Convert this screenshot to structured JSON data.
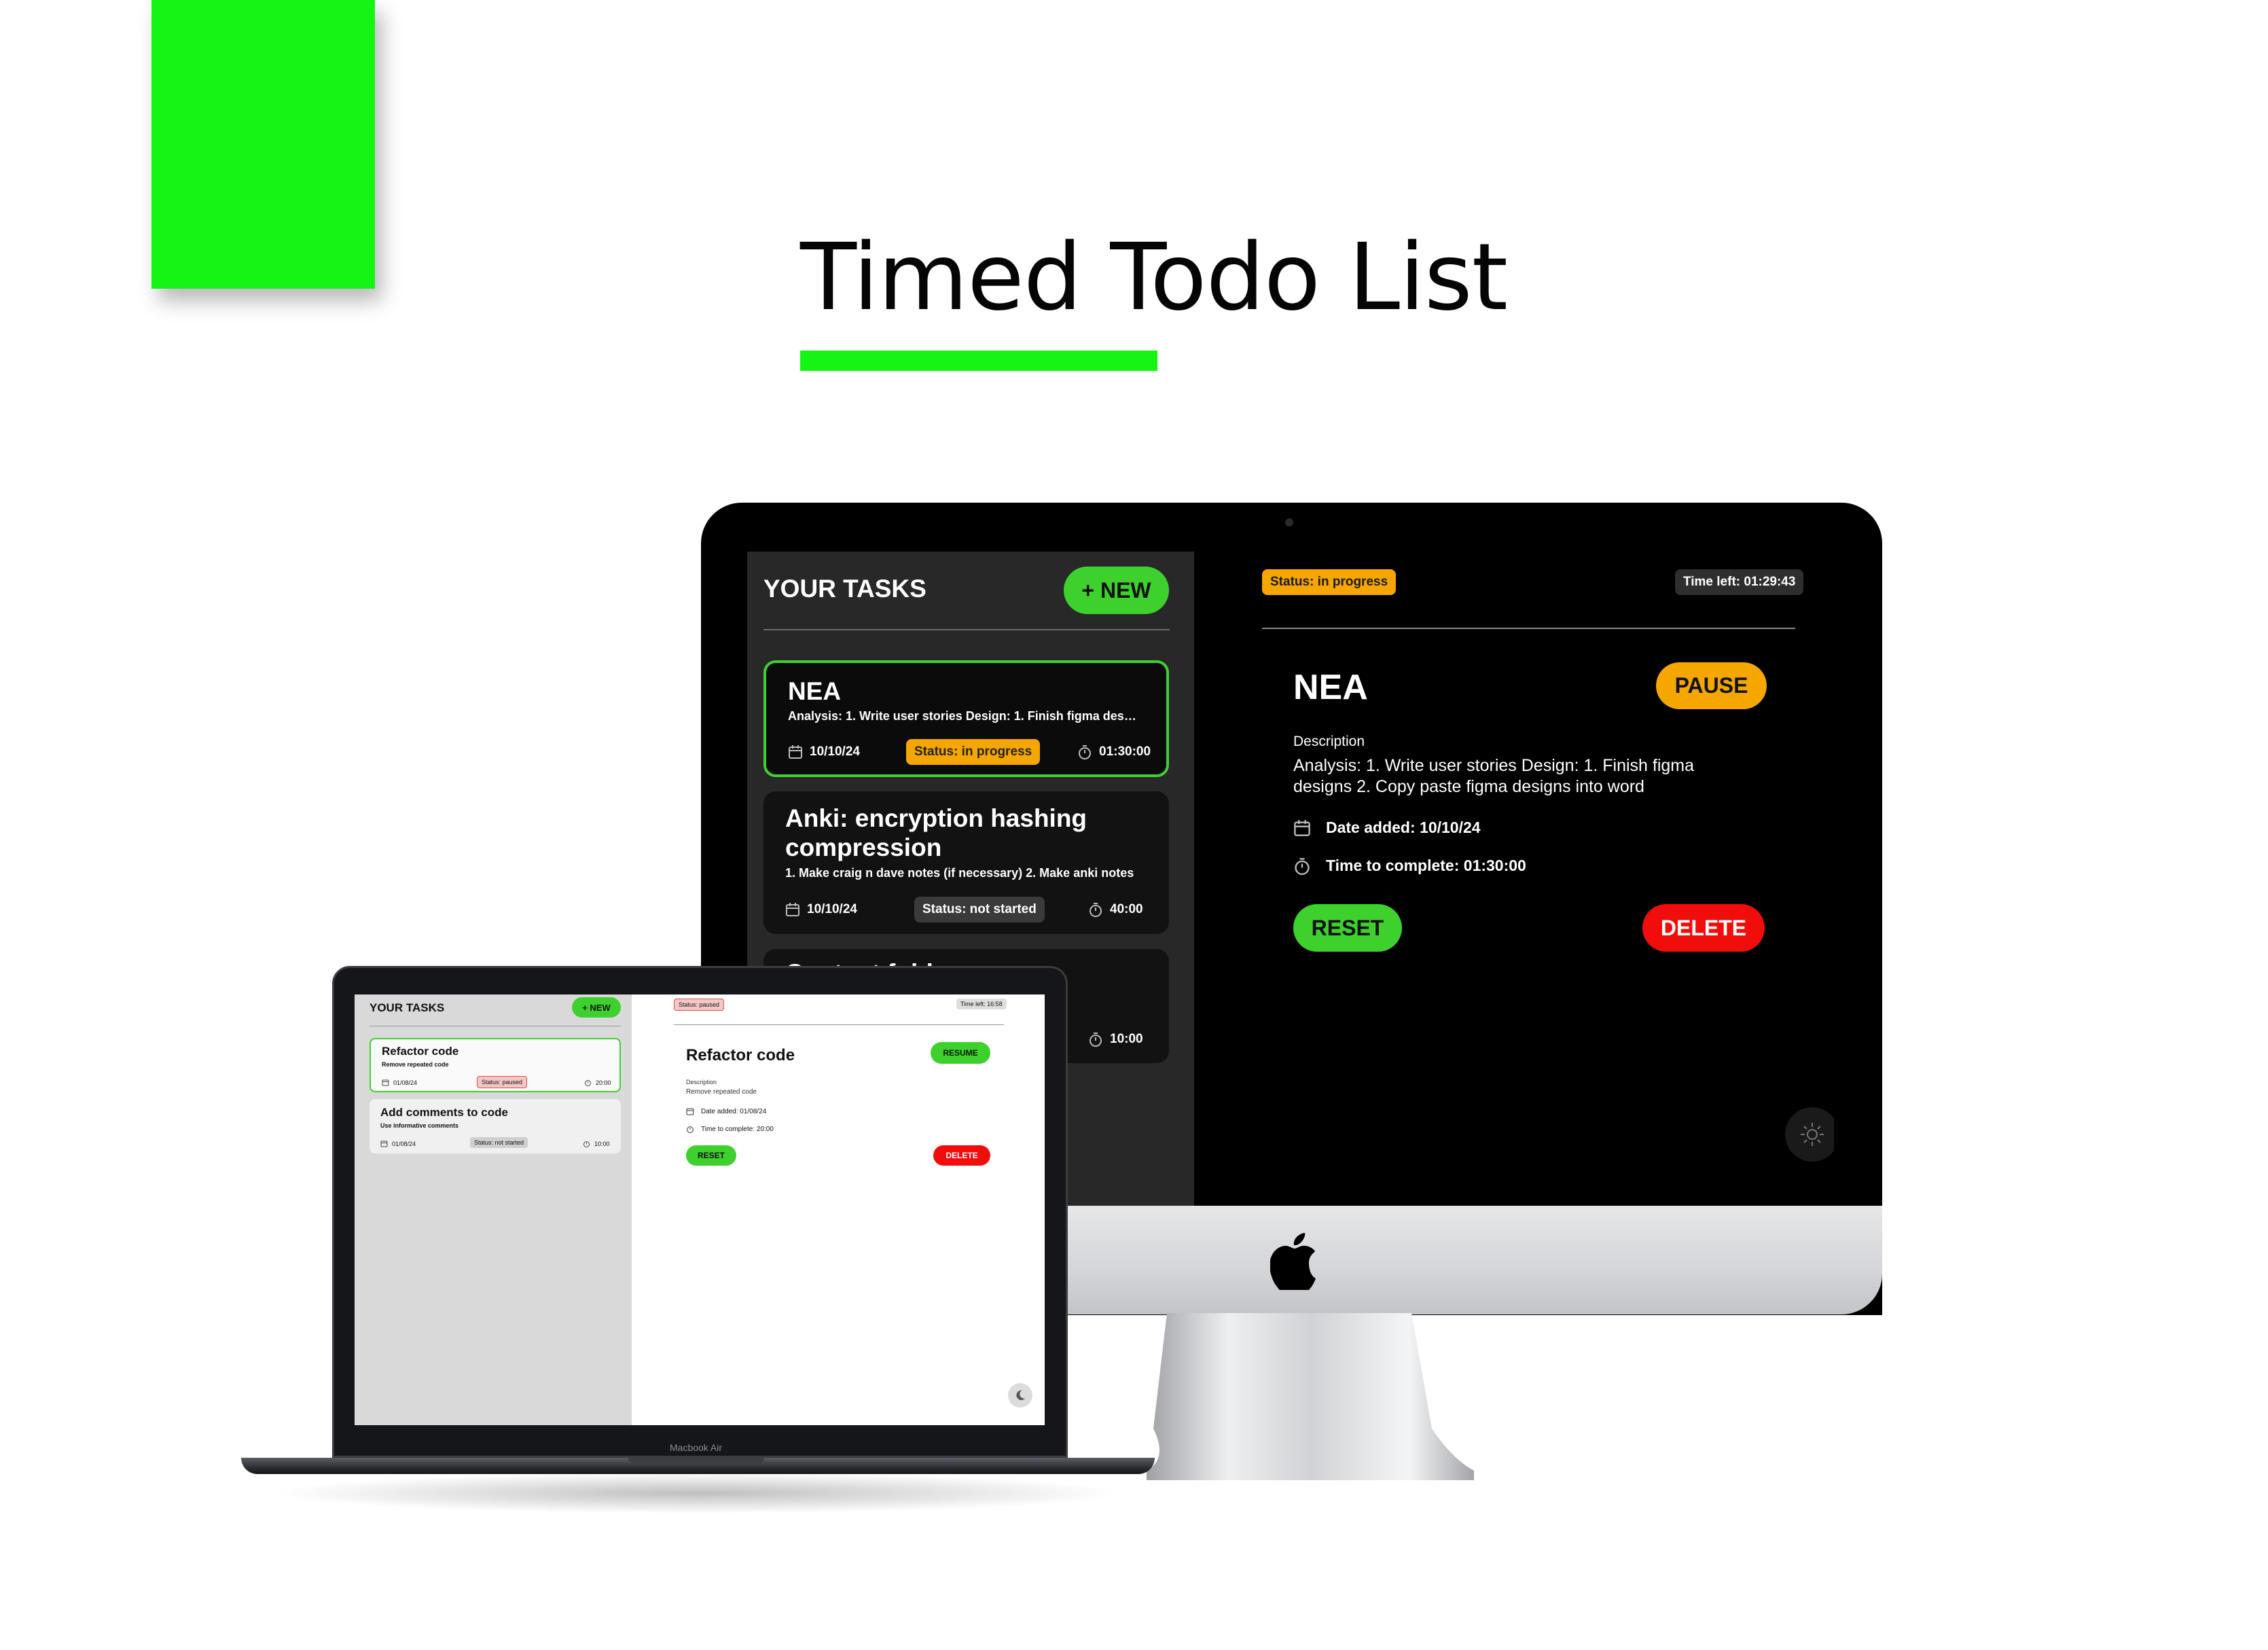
{
  "hero": {
    "title": "Timed Todo List",
    "accent_color": "#16f416"
  },
  "desktop": {
    "sidebar": {
      "title": "YOUR TASKS",
      "new_button": "+ NEW",
      "tasks": [
        {
          "title": "NEA",
          "description": "Analysis: 1. Write user stories Design: 1. Finish figma des…",
          "date": "10/10/24",
          "status": "Status: in progress",
          "duration": "01:30:00",
          "active": true
        },
        {
          "title": "Anki: encryption hashing compression",
          "description": "1. Make craig n dave notes (if necessary) 2. Make anki notes",
          "date": "10/10/24",
          "status": "Status: not started",
          "duration": "40:00",
          "active": false
        },
        {
          "title": "Content fold…",
          "duration": "10:00",
          "active": false
        }
      ]
    },
    "main": {
      "status": "Status: in progress",
      "time_left": "Time left: 01:29:43",
      "title": "NEA",
      "pause_button": "PAUSE",
      "description_label": "Description",
      "description": "Analysis: 1. Write user stories Design: 1. Finish figma designs 2. Copy paste figma designs into word",
      "date_added": "Date added: 10/10/24",
      "time_to_complete": "Time to complete: 01:30:00",
      "reset_button": "RESET",
      "delete_button": "DELETE"
    },
    "theme_icon": "sun-icon"
  },
  "laptop": {
    "device_label": "Macbook Air",
    "sidebar": {
      "title": "YOUR TASKS",
      "new_button": "+ NEW",
      "tasks": [
        {
          "title": "Refactor code",
          "description": "Remove repeated code",
          "date": "01/08/24",
          "status": "Status: paused",
          "duration": "20:00",
          "active": true
        },
        {
          "title": "Add comments to code",
          "description": "Use informative comments",
          "date": "01/08/24",
          "status": "Status: not started",
          "duration": "10:00",
          "active": false
        }
      ]
    },
    "main": {
      "status": "Status: paused",
      "time_left": "Time left: 16:58",
      "title": "Refactor code",
      "resume_button": "RESUME",
      "description_label": "Description",
      "description": "Remove repeated code",
      "date_added": "Date added: 01/08/24",
      "time_to_complete": "Time to complete: 20:00",
      "reset_button": "RESET",
      "delete_button": "DELETE"
    },
    "theme_icon": "moon-icon"
  },
  "colors": {
    "green": "#3ed12e",
    "orange": "#f5a700",
    "red": "#f20d0d"
  }
}
